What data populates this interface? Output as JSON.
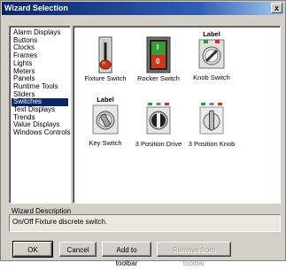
{
  "window": {
    "title": "Wizard Selection",
    "close": "x"
  },
  "categories": [
    "Alarm Displays",
    "Buttons",
    "Clocks",
    "Frames",
    "Lights",
    "Meters",
    "Panels",
    "Runtime Tools",
    "Sliders",
    "Switches",
    "Text Displays",
    "Trends",
    "Value Displays",
    "Windows Controls"
  ],
  "selected_category": "Switches",
  "wizards": [
    {
      "label": "Fixture Switch",
      "icon": "toggle-switch-icon"
    },
    {
      "label": "Rocker Switch",
      "icon": "rocker-switch-icon",
      "top": "I",
      "bottom": "0"
    },
    {
      "label": "Knob Switch",
      "icon": "knob-switch-icon",
      "caption": "Label"
    },
    {
      "label": "Key Switch",
      "icon": "key-switch-icon",
      "caption": "Label"
    },
    {
      "label": "3 Position Drive",
      "icon": "three-position-drive-icon"
    },
    {
      "label": "3 Position Knob",
      "icon": "three-position-knob-icon"
    }
  ],
  "description": {
    "label": "Wizard Description",
    "text": "On/Off Fixture discrete switch."
  },
  "buttons": {
    "ok": "OK",
    "cancel": "Cancel",
    "add": "Add to toolbar",
    "remove": "Remove from toolbar"
  },
  "colors": {
    "title_start": "#0a246a",
    "selection": "#0a246a",
    "rocker_on": "#3a9a3a",
    "rocker_off": "#c83a1a",
    "lamp_green": "#2a9a2a",
    "lamp_red": "#d03020"
  }
}
